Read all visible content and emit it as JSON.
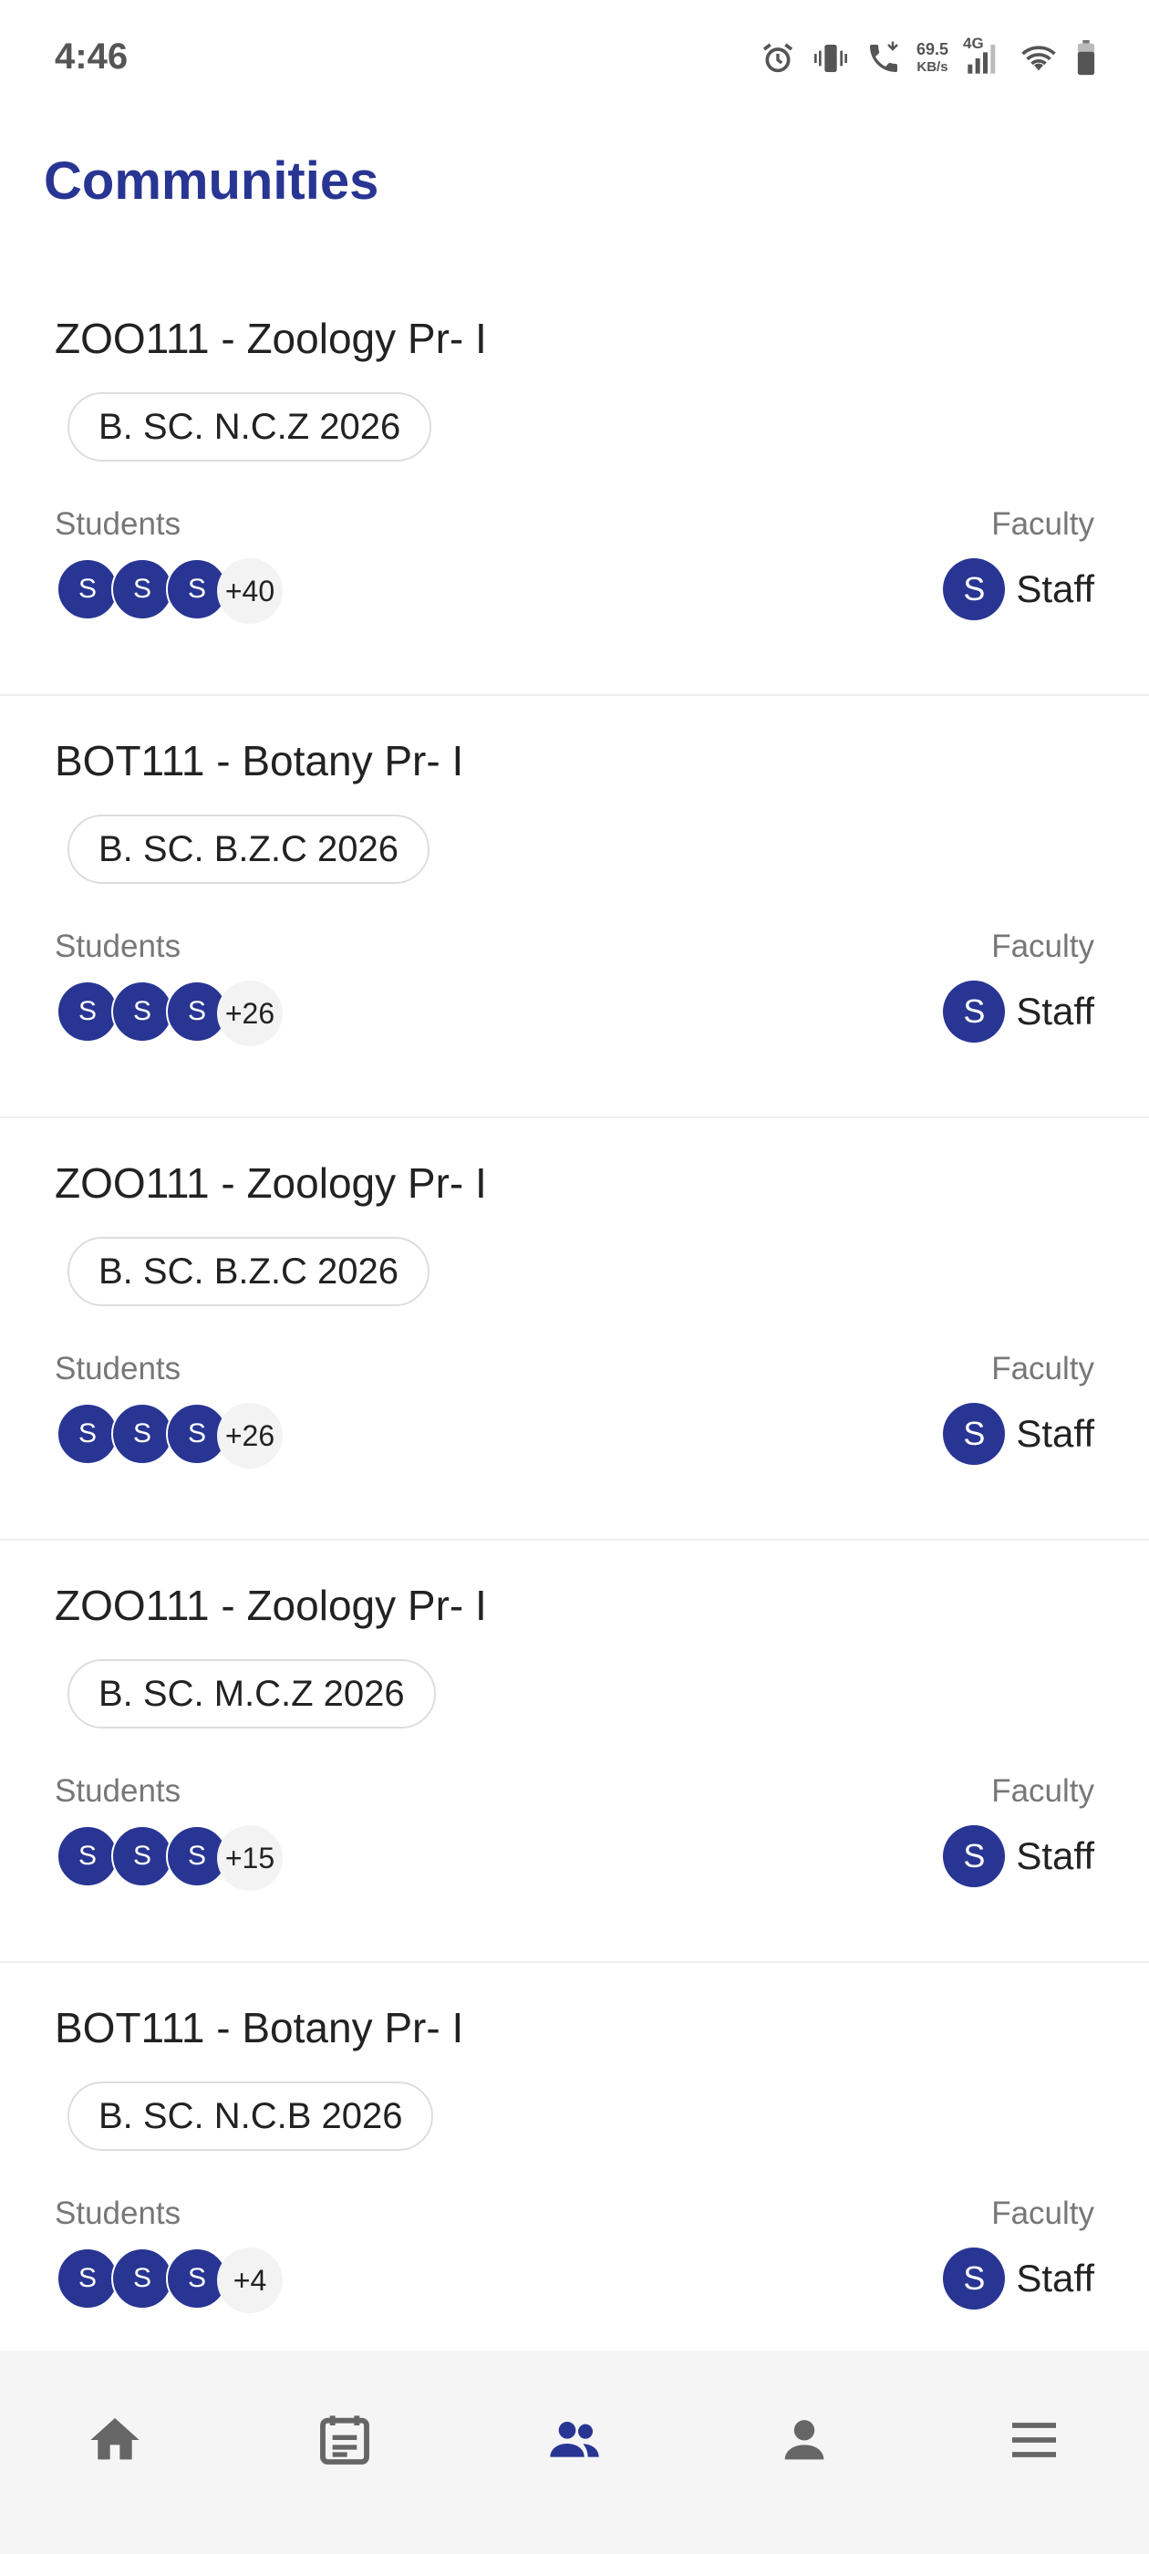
{
  "status": {
    "time": "4:46",
    "net_speed_value": "69.5",
    "net_speed_unit": "KB/s",
    "network_type": "4G",
    "icons": [
      "alarm-icon",
      "vibrate-icon",
      "call-icon",
      "signal-icon",
      "wifi-icon",
      "battery-icon"
    ]
  },
  "header": {
    "title": "Communities"
  },
  "labels": {
    "students": "Students",
    "faculty": "Faculty"
  },
  "communities": [
    {
      "title": "ZOO111 - Zoology Pr- I",
      "batch": "B. SC. N.C.Z 2026",
      "student_initials": [
        "S",
        "S",
        "S"
      ],
      "more_students": "+40",
      "faculty_initial": "S",
      "faculty_name": "Staff"
    },
    {
      "title": "BOT111 - Botany Pr- I",
      "batch": "B. SC. B.Z.C 2026",
      "student_initials": [
        "S",
        "S",
        "S"
      ],
      "more_students": "+26",
      "faculty_initial": "S",
      "faculty_name": "Staff"
    },
    {
      "title": "ZOO111 - Zoology Pr- I",
      "batch": "B. SC. B.Z.C 2026",
      "student_initials": [
        "S",
        "S",
        "S"
      ],
      "more_students": "+26",
      "faculty_initial": "S",
      "faculty_name": "Staff"
    },
    {
      "title": "ZOO111 - Zoology Pr- I",
      "batch": "B. SC. M.C.Z 2026",
      "student_initials": [
        "S",
        "S",
        "S"
      ],
      "more_students": "+15",
      "faculty_initial": "S",
      "faculty_name": "Staff"
    },
    {
      "title": "BOT111 - Botany Pr- I",
      "batch": "B. SC. N.C.B 2026",
      "student_initials": [
        "S",
        "S",
        "S"
      ],
      "more_students": "+4",
      "faculty_initial": "S",
      "faculty_name": "Staff"
    }
  ],
  "bottom_nav": {
    "items": [
      {
        "icon": "home-icon",
        "active": false
      },
      {
        "icon": "calendar-icon",
        "active": false
      },
      {
        "icon": "communities-icon",
        "active": true
      },
      {
        "icon": "profile-icon",
        "active": false
      },
      {
        "icon": "menu-icon",
        "active": false
      }
    ],
    "active_color": "#283593",
    "inactive_color": "#666666"
  },
  "colors": {
    "accent": "#283593",
    "chip_border": "#dddddd",
    "divider": "#eeeeee"
  }
}
